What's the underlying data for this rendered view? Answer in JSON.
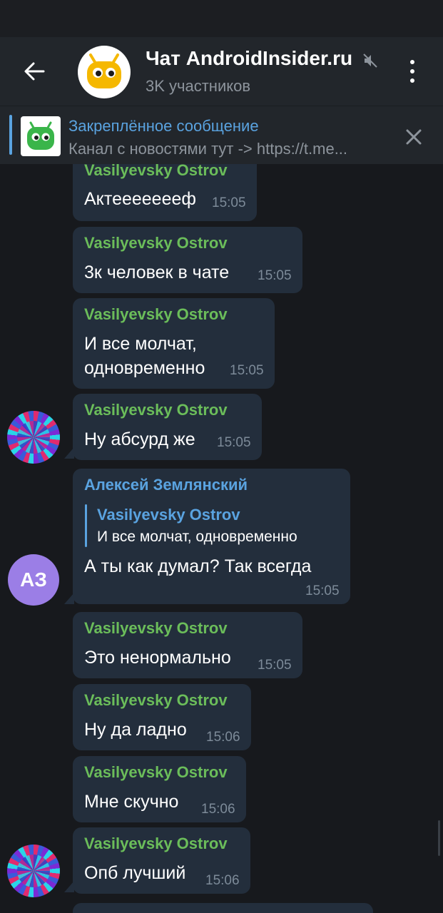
{
  "header": {
    "title": "Чат AndroidInsider.ru",
    "subtitle": "3K участников"
  },
  "pinned": {
    "title": "Закреплённое сообщение",
    "text": "Канал с новостями тут -> https://t.me..."
  },
  "messages": [
    {
      "sender": "Vasilyevsky Ostrov",
      "lines": [
        "Актеееееееф"
      ],
      "time": "15:05"
    },
    {
      "sender": "Vasilyevsky Ostrov",
      "lines": [
        "3к человек в чате"
      ],
      "time": "15:05"
    },
    {
      "sender": "Vasilyevsky Ostrov",
      "lines": [
        "И все молчат,",
        "одновременно"
      ],
      "time": "15:05"
    },
    {
      "sender": "Vasilyevsky Ostrov",
      "lines": [
        "Ну абсурд же"
      ],
      "time": "15:05"
    },
    {
      "sender": "Алексей Землянский",
      "reply_to": "Vasilyevsky Ostrov",
      "reply_text": "И все молчат, одновременно",
      "lines": [
        "А ты как думал? Так всегда"
      ],
      "time": "15:05",
      "avatar_initials": "АЗ"
    },
    {
      "sender": "Vasilyevsky Ostrov",
      "lines": [
        "Это ненормально"
      ],
      "time": "15:05"
    },
    {
      "sender": "Vasilyevsky Ostrov",
      "lines": [
        "Ну да ладно"
      ],
      "time": "15:06"
    },
    {
      "sender": "Vasilyevsky Ostrov",
      "lines": [
        "Мне скучно"
      ],
      "time": "15:06"
    },
    {
      "sender": "Vasilyevsky Ostrov",
      "lines": [
        "Опб лучший"
      ],
      "time": "15:06"
    }
  ],
  "colors": {
    "background": "#17191d",
    "header": "#22262b",
    "bubble": "#232e3c",
    "sender_green": "#6bbd5a",
    "sender_blue": "#5aa3e0",
    "time": "#7d8b99",
    "avatar_initials_bg": "#9b7ee6"
  },
  "icons": [
    "back-arrow-icon",
    "mute-icon",
    "more-vert-icon",
    "close-icon",
    "android-logo-icon"
  ]
}
